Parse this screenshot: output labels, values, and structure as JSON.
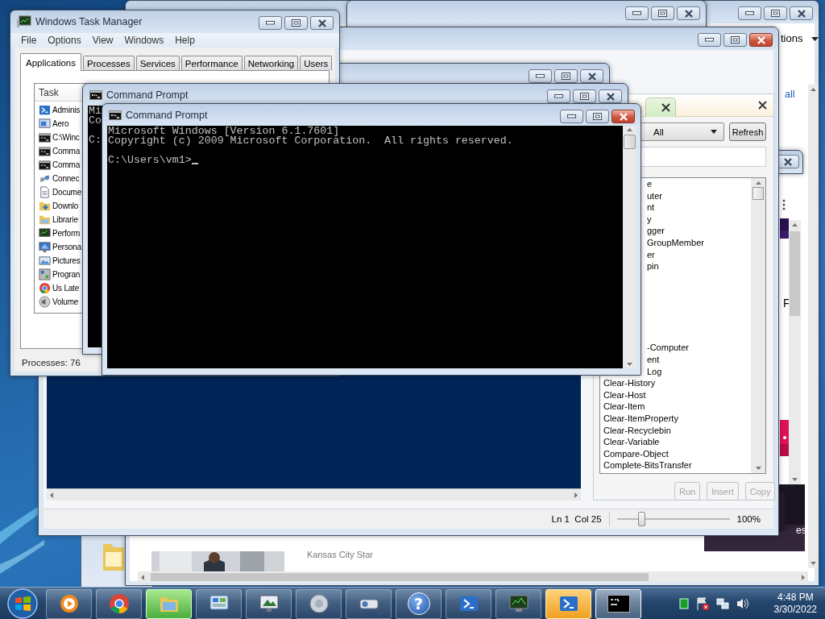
{
  "browser_window": {
    "menu_label": "tions",
    "link": "all",
    "side_letter": "F",
    "overlay_text": "es",
    "source": "Kansas City Star"
  },
  "powershell_ise": {
    "focused": true,
    "commands_pane": {
      "module_filter": "All",
      "refresh_button": "Refresh",
      "upper_items": [
        {
          "text": "e",
          "kind": "partial"
        },
        {
          "text": "uter",
          "kind": "partial"
        },
        {
          "text": "nt",
          "kind": "partial"
        },
        {
          "text": "y",
          "kind": "partial"
        },
        {
          "text": "gger",
          "kind": "partial"
        },
        {
          "text": "GroupMember",
          "kind": "partial"
        },
        {
          "text": "er",
          "kind": "partial"
        },
        {
          "text": "pin",
          "kind": "partial"
        }
      ],
      "lower_items": [
        {
          "text": "-Computer",
          "kind": "partial"
        },
        {
          "text": "ent",
          "kind": "partial"
        },
        {
          "text": "Log",
          "kind": "partial"
        },
        {
          "text": "Clear-History",
          "kind": "full"
        },
        {
          "text": "Clear-Host",
          "kind": "full"
        },
        {
          "text": "Clear-Item",
          "kind": "full"
        },
        {
          "text": "Clear-ItemProperty",
          "kind": "full"
        },
        {
          "text": "Clear-Recyclebin",
          "kind": "full"
        },
        {
          "text": "Clear-Variable",
          "kind": "full"
        },
        {
          "text": "Compare-Object",
          "kind": "full"
        },
        {
          "text": "Complete-BitsTransfer",
          "kind": "full"
        }
      ],
      "buttons": [
        {
          "label": "Run",
          "disabled": true
        },
        {
          "label": "Insert",
          "disabled": true
        },
        {
          "label": "Copy",
          "disabled": true
        }
      ]
    },
    "status_bar": {
      "position": "Ln 1  Col 25",
      "zoom_slider": {
        "level": 0.2
      },
      "zoom": "100%"
    }
  },
  "task_manager": {
    "title": "Windows Task Manager",
    "focused": false,
    "menu": [
      "File",
      "Options",
      "View",
      "Windows",
      "Help"
    ],
    "tabs": [
      {
        "label": "Applications",
        "selected": true
      },
      {
        "label": "Processes",
        "selected": false
      },
      {
        "label": "Services",
        "selected": false
      },
      {
        "label": "Performance",
        "selected": false
      },
      {
        "label": "Networking",
        "selected": false
      },
      {
        "label": "Users",
        "selected": false
      }
    ],
    "column": "Task",
    "tasks": [
      {
        "name": "Adminis",
        "kind": "powershell"
      },
      {
        "name": "Aero",
        "kind": "aero"
      },
      {
        "name": "C:\\Winc",
        "kind": "cmd"
      },
      {
        "name": "Comma",
        "kind": "cmd"
      },
      {
        "name": "Comma",
        "kind": "cmd"
      },
      {
        "name": "Connec",
        "kind": "network"
      },
      {
        "name": "Docume",
        "kind": "document"
      },
      {
        "name": "Downlo",
        "kind": "download"
      },
      {
        "name": "Librarie",
        "kind": "library"
      },
      {
        "name": "Perform",
        "kind": "monitor"
      },
      {
        "name": "Persona",
        "kind": "personalize"
      },
      {
        "name": "Pictures",
        "kind": "pictures"
      },
      {
        "name": "Progran",
        "kind": "programs"
      },
      {
        "name": "Us Late",
        "kind": "chrome"
      },
      {
        "name": "Volume",
        "kind": "volume"
      }
    ],
    "status": "Processes: 76"
  },
  "back_command_prompt": {
    "title": "Command Prompt",
    "focused": false,
    "lines": [
      "Mi",
      "Co"
    ],
    "prompt": "C:"
  },
  "command_prompt": {
    "title": "Command Prompt",
    "focused": true,
    "lines": [
      "Microsoft Windows [Version 6.1.7601]",
      "Copyright (c) 2009 Microsoft Corporation.  All rights reserved."
    ],
    "prompt": "C:\\Users\\vm1>",
    "cursor": true
  },
  "taskbar": {
    "buttons": [
      {
        "kind": "media",
        "hovered": false,
        "flashing": false,
        "active": false
      },
      {
        "kind": "chrome",
        "hovered": false,
        "flashing": false,
        "active": false
      },
      {
        "kind": "explorer",
        "hovered": true,
        "flashing": false,
        "active": false
      },
      {
        "kind": "control",
        "hovered": false,
        "flashing": false,
        "active": false
      },
      {
        "kind": "display",
        "hovered": false,
        "flashing": false,
        "active": false
      },
      {
        "kind": "speaker",
        "hovered": false,
        "flashing": false,
        "active": false
      },
      {
        "kind": "projector",
        "hovered": false,
        "flashing": false,
        "active": false
      },
      {
        "kind": "help",
        "hovered": false,
        "flashing": false,
        "active": false,
        "glyph": "?"
      },
      {
        "kind": "powershell",
        "hovered": false,
        "flashing": false,
        "active": false
      },
      {
        "kind": "monitor",
        "hovered": false,
        "flashing": false,
        "active": false
      },
      {
        "kind": "powershell",
        "hovered": false,
        "flashing": true,
        "active": false
      },
      {
        "kind": "cmd",
        "hovered": false,
        "flashing": false,
        "active": true
      }
    ],
    "clock": {
      "time": "4:48 PM",
      "date": "3/30/2022"
    }
  }
}
